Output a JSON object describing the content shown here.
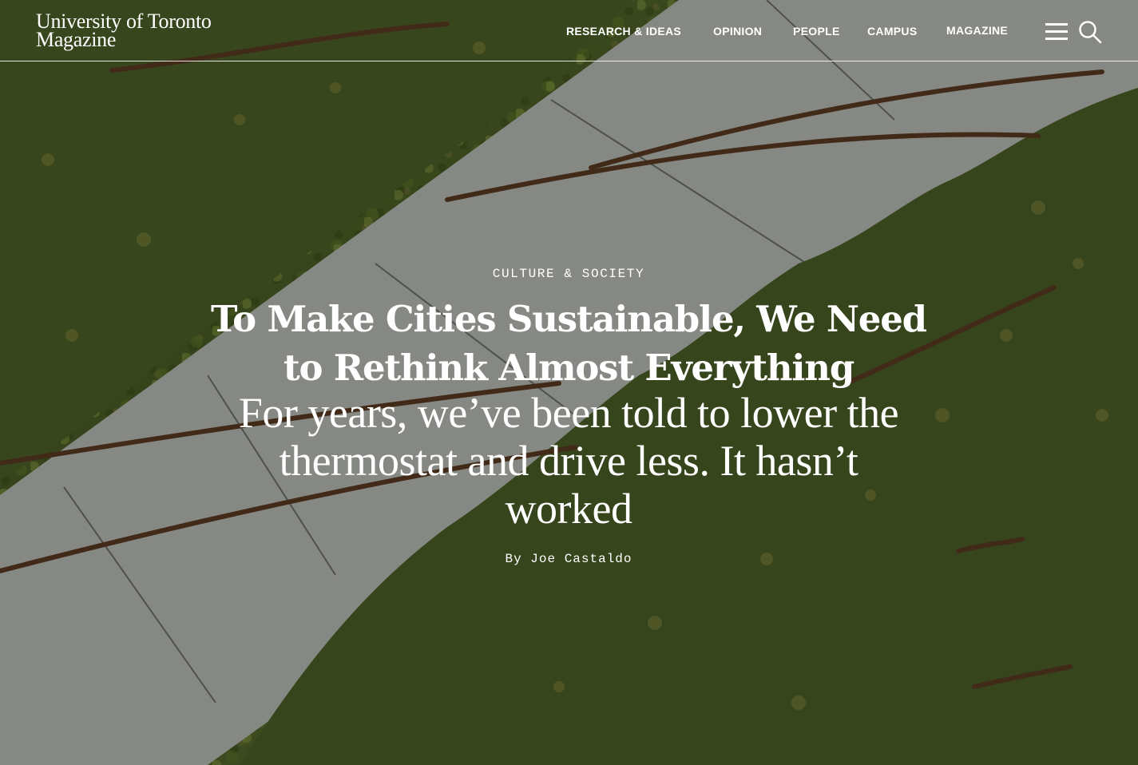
{
  "site": {
    "logo_line1": "University of Toronto",
    "logo_line2": "Magazine"
  },
  "nav": {
    "items": [
      {
        "label": "RESEARCH & IDEAS"
      },
      {
        "label": "OPINION"
      },
      {
        "label": "PEOPLE"
      },
      {
        "label": "CAMPUS"
      },
      {
        "label": "MAGAZINE"
      }
    ],
    "menu_icon": "hamburger-menu-icon",
    "search_icon": "search-icon"
  },
  "article": {
    "category": "CULTURE & SOCIETY",
    "headline": "To Make Cities Sustainable, We Need to Rethink Almost Everything",
    "dek": "For years, we’ve been told to lower the thermostat and drive less. It hasn’t worked",
    "byline": "By Joe Castaldo"
  },
  "colors": {
    "text": "#ffffff",
    "foliage": "#4b5e27",
    "path": "#b9bcb4"
  }
}
